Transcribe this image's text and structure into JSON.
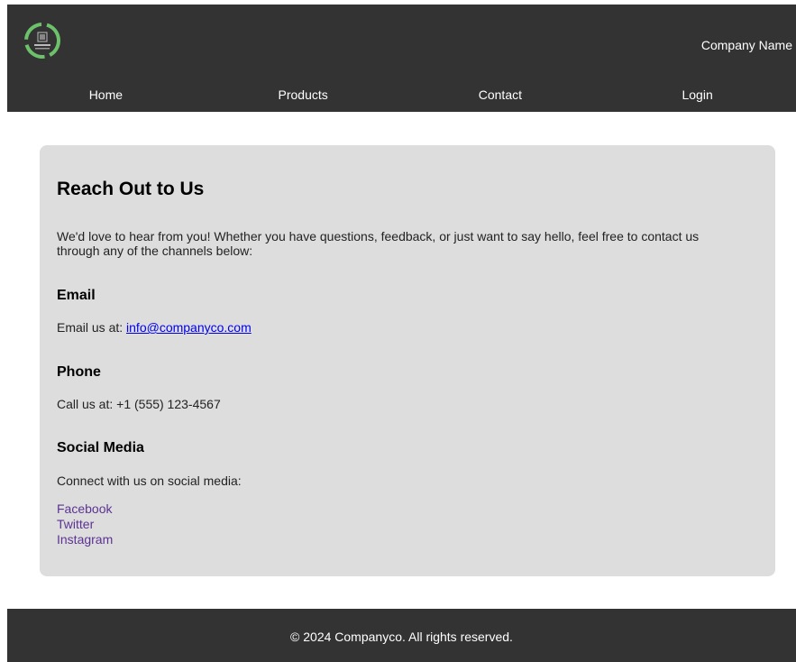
{
  "header": {
    "logo_icon": "leaf-ring-logo-icon",
    "company_name": "Company Name",
    "background": "#333333"
  },
  "nav": {
    "items": [
      {
        "label": "Home"
      },
      {
        "label": "Products"
      },
      {
        "label": "Contact"
      },
      {
        "label": "Login"
      }
    ]
  },
  "main": {
    "title": "Reach Out to Us",
    "intro": "We'd love to hear from you! Whether you have questions, feedback, or just want to say hello, feel free to contact us through any of the channels below:",
    "email": {
      "heading": "Email",
      "prefix": "Email us at: ",
      "address": "info@companyco.com"
    },
    "phone": {
      "heading": "Phone",
      "text": "Call us at: +1 (555) 123-4567"
    },
    "social": {
      "heading": "Social Media",
      "text": "Connect with us on social media:",
      "links": [
        {
          "label": "Facebook"
        },
        {
          "label": "Twitter"
        },
        {
          "label": "Instagram"
        }
      ]
    }
  },
  "footer": {
    "text": "© 2024 Companyco. All rights reserved."
  },
  "colors": {
    "header_bg": "#333333",
    "card_bg": "#dddddd",
    "link": "#0000ee",
    "visited_link": "#5c3393",
    "logo_green": "#6cc26a"
  }
}
